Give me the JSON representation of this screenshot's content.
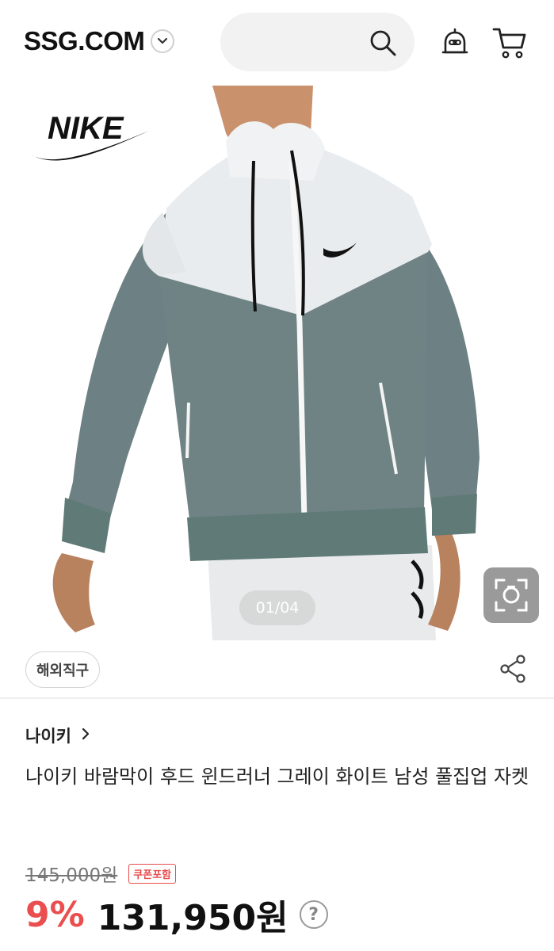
{
  "header": {
    "brand": "SSG.COM",
    "icons": [
      "chevron-down-icon",
      "search-icon",
      "bell-icon",
      "cart-icon"
    ]
  },
  "hero": {
    "pager": "01/04",
    "brand_logo_text": "NIKE",
    "colors": {
      "jacket_top": "#e9ecee",
      "jacket_bottom": "#6f8385",
      "rib": "#5f7a77"
    }
  },
  "badge": {
    "overseas": "해외직구"
  },
  "product": {
    "brand": "나이키",
    "name": "나이키 바람막이 후드 윈드러너 그레이 화이트 남성 풀집업 자켓",
    "original_price": "145,000원",
    "coupon_label": "쿠폰포함",
    "discount": "9%",
    "sale_price": "131,950원",
    "help": "?"
  },
  "colors": {
    "accent_red": "#ea4e4e"
  }
}
